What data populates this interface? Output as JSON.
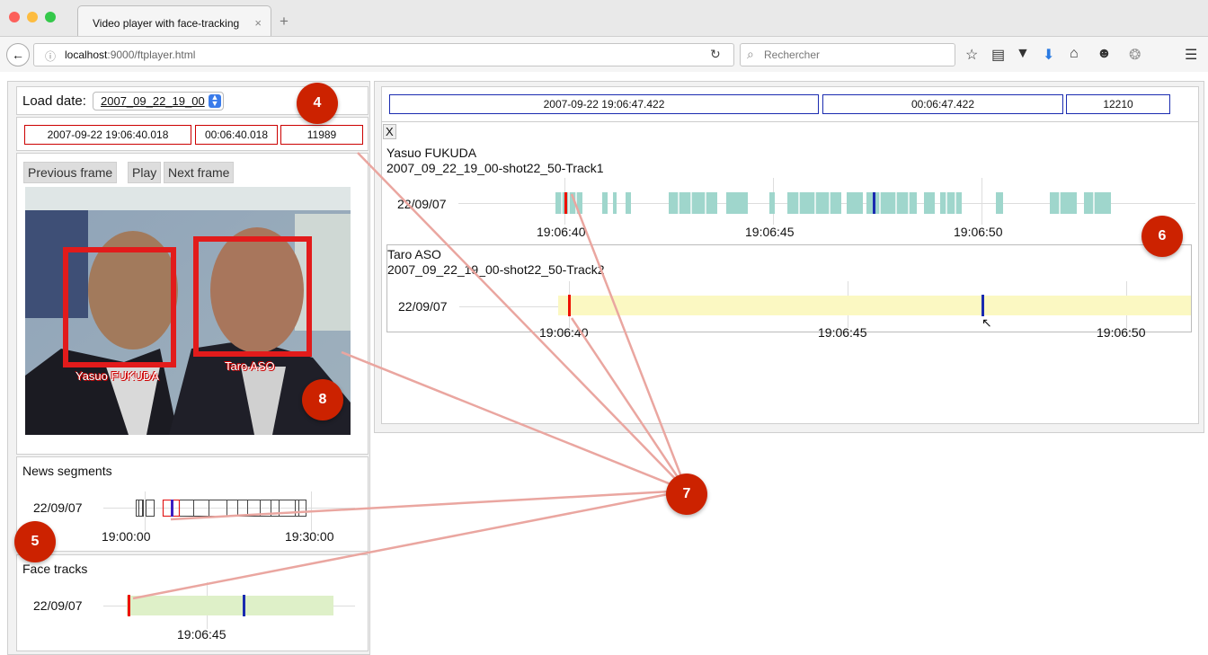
{
  "browser": {
    "tab_title": "Video player with face-tracking",
    "tab_close": "×",
    "new_tab": "+",
    "url_host": "localhost",
    "url_path": ":9000/ftplayer.html",
    "search_placeholder": "Rechercher"
  },
  "left": {
    "load_label": "Load date:",
    "load_value": "2007_09_22_19_00",
    "timestamp": "2007-09-22 19:06:40.018",
    "offset": "00:06:40.018",
    "frame": "11989",
    "buttons": {
      "prev": "Previous frame",
      "play": "Play",
      "next": "Next frame"
    },
    "faces": [
      {
        "name": "Yasuo FUKUDA"
      },
      {
        "name": "Taro ASO"
      }
    ],
    "news_title": "News segments",
    "news_date": "22/09/07",
    "news_ticks": [
      "19:00:00",
      "19:30:00"
    ],
    "face_title": "Face tracks",
    "face_date": "22/09/07",
    "face_ticks": [
      "19:06:45"
    ]
  },
  "right": {
    "timestamp": "2007-09-22 19:06:47.422",
    "offset": "00:06:47.422",
    "frame": "12210",
    "close": "X",
    "tracks": [
      {
        "name": "Yasuo FUKUDA",
        "id": "2007_09_22_19_00-shot22_50-Track1",
        "date": "22/09/07",
        "ticks": [
          "19:06:40",
          "19:06:45",
          "19:06:50"
        ]
      },
      {
        "name": "Taro ASO",
        "id": "2007_09_22_19_00-shot22_50-Track2",
        "date": "22/09/07",
        "ticks": [
          "19:06:40",
          "19:06:45",
          "19:06:50"
        ]
      }
    ]
  },
  "badges": {
    "b4": "4",
    "b5": "5",
    "b6": "6",
    "b7": "7",
    "b8": "8"
  },
  "colors": {
    "badge": "#cc2200",
    "current_marker": "#ee1100",
    "cursor_marker": "#1a2bb0",
    "track1": "#9fd6cc",
    "track2": "#fbf8c2",
    "face_tracks": "#def0c8",
    "arrow": "#eaa6a0"
  }
}
